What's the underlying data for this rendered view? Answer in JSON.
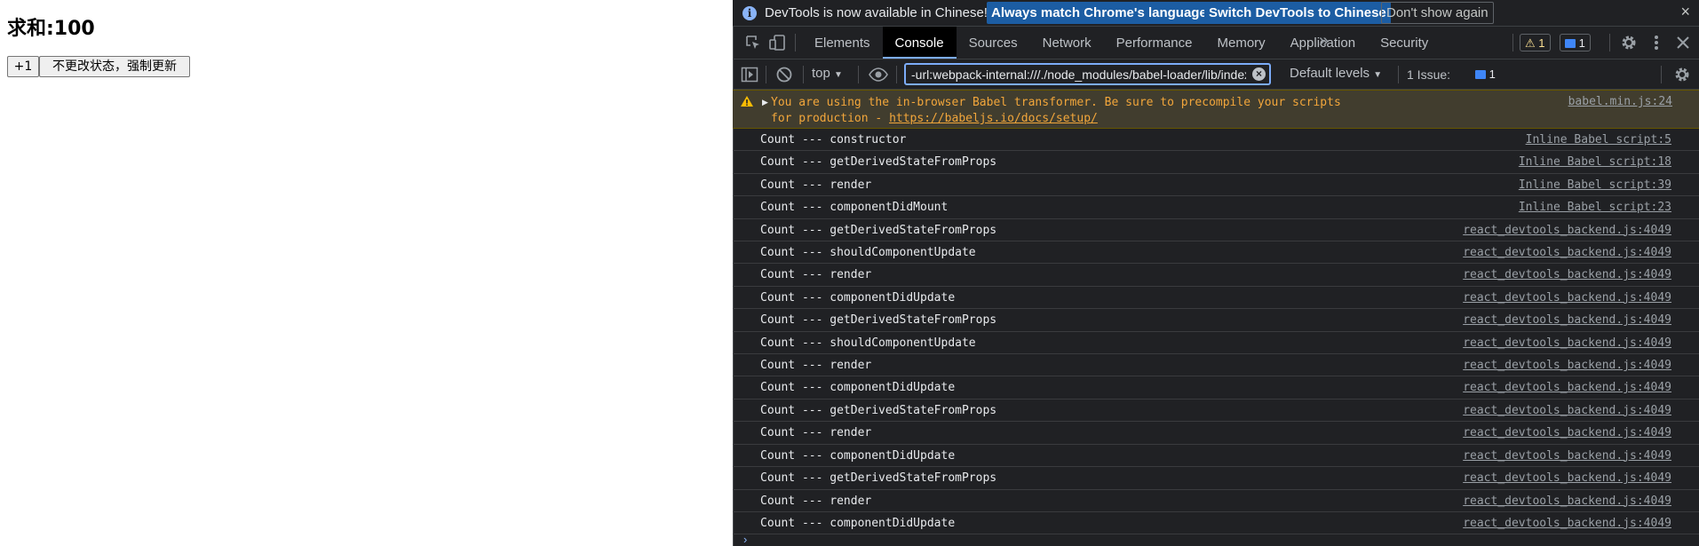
{
  "page": {
    "heading": "求和:100",
    "increment_label": "+1",
    "force_update_label": "不更改状态，强制更新"
  },
  "devtools": {
    "infobar": {
      "message": "DevTools is now available in Chinese!",
      "btn_match": "Always match Chrome's language",
      "btn_switch": "Switch DevTools to Chinese",
      "btn_dismiss": "Don't show again",
      "close": "×"
    },
    "tabs": [
      "Elements",
      "Console",
      "Sources",
      "Network",
      "Performance",
      "Memory",
      "Application",
      "Security"
    ],
    "active_tab": "Console",
    "more_tabs": "»",
    "warn_count": "1",
    "msg_count": "1",
    "toolbar": {
      "context": "top",
      "filter_value": "-url:webpack-internal:///./node_modules/babel-loader/lib/index.js!./node_modules/vue",
      "levels": "Default levels",
      "issues_label": "1 Issue:",
      "issues_count": "1"
    },
    "warning": {
      "text": "You are using the in-browser Babel transformer. Be sure to precompile your scripts for production - ",
      "link": "https://babeljs.io/docs/setup/",
      "source": "babel.min.js:24"
    },
    "logs": [
      {
        "message": "Count --- constructor",
        "source": "Inline Babel script:5"
      },
      {
        "message": "Count --- getDerivedStateFromProps",
        "source": "Inline Babel script:18"
      },
      {
        "message": "Count --- render",
        "source": "Inline Babel script:39"
      },
      {
        "message": "Count --- componentDidMount",
        "source": "Inline Babel script:23"
      },
      {
        "message": "Count --- getDerivedStateFromProps",
        "source": "react_devtools_backend.js:4049"
      },
      {
        "message": "Count --- shouldComponentUpdate",
        "source": "react_devtools_backend.js:4049"
      },
      {
        "message": "Count --- render",
        "source": "react_devtools_backend.js:4049"
      },
      {
        "message": "Count --- componentDidUpdate",
        "source": "react_devtools_backend.js:4049"
      },
      {
        "message": "Count --- getDerivedStateFromProps",
        "source": "react_devtools_backend.js:4049"
      },
      {
        "message": "Count --- shouldComponentUpdate",
        "source": "react_devtools_backend.js:4049"
      },
      {
        "message": "Count --- render",
        "source": "react_devtools_backend.js:4049"
      },
      {
        "message": "Count --- componentDidUpdate",
        "source": "react_devtools_backend.js:4049"
      },
      {
        "message": "Count --- getDerivedStateFromProps",
        "source": "react_devtools_backend.js:4049"
      },
      {
        "message": "Count --- render",
        "source": "react_devtools_backend.js:4049"
      },
      {
        "message": "Count --- componentDidUpdate",
        "source": "react_devtools_backend.js:4049"
      },
      {
        "message": "Count --- getDerivedStateFromProps",
        "source": "react_devtools_backend.js:4049"
      },
      {
        "message": "Count --- render",
        "source": "react_devtools_backend.js:4049"
      },
      {
        "message": "Count --- componentDidUpdate",
        "source": "react_devtools_backend.js:4049"
      }
    ],
    "prompt": "›"
  }
}
